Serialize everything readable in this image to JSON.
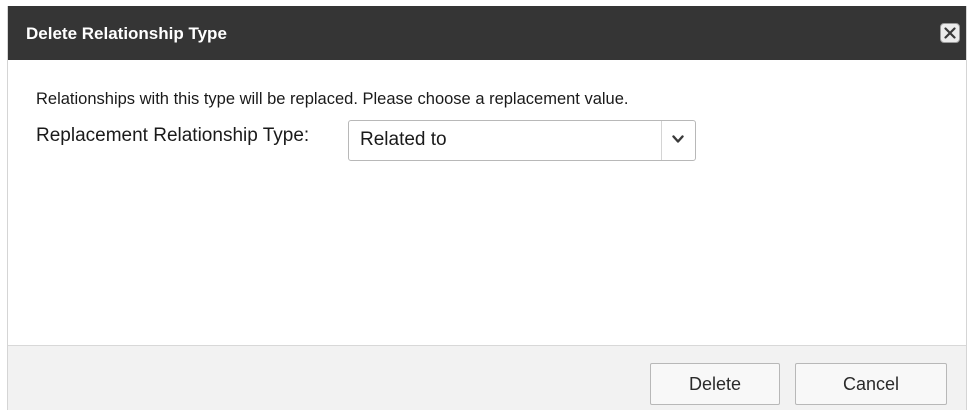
{
  "dialog": {
    "title": "Delete Relationship Type",
    "close_icon": "close-icon",
    "instruction": "Relationships with this type will be replaced. Please choose a replacement value.",
    "field_label": "Replacement Relationship Type:",
    "select": {
      "value": "Related to",
      "arrow_icon": "chevron-down-icon"
    },
    "buttons": {
      "delete_label": "Delete",
      "cancel_label": "Cancel"
    }
  },
  "colors": {
    "titlebar": "#353535",
    "title_text": "#ffffff",
    "footer": "#f2f2f2",
    "body": "#ffffff"
  }
}
